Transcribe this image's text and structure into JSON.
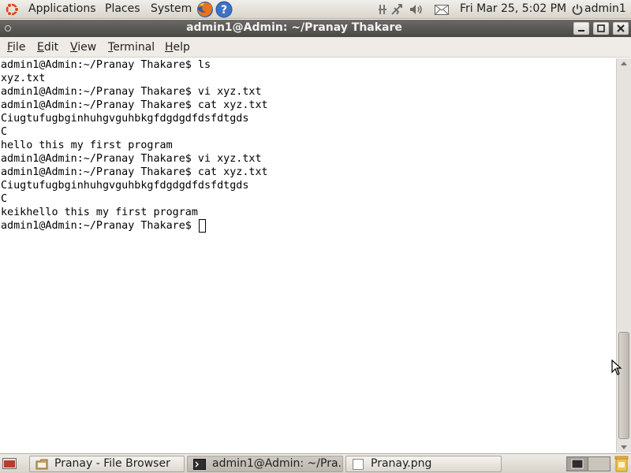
{
  "top_panel": {
    "menus": [
      "Applications",
      "Places",
      "System"
    ],
    "clock": "Fri Mar 25,  5:02 PM",
    "user": "admin1",
    "icons": [
      "ubuntu-logo-icon",
      "firefox-icon",
      "help-icon",
      "network-icon",
      "bluetooth-icon",
      "volume-icon",
      "mail-icon",
      "power-icon"
    ]
  },
  "window": {
    "title": "admin1@Admin: ~/Pranay Thakare"
  },
  "menubar": {
    "items": [
      {
        "label": "File",
        "mnemonic": "F",
        "rest": "ile"
      },
      {
        "label": "Edit",
        "mnemonic": "E",
        "rest": "dit"
      },
      {
        "label": "View",
        "mnemonic": "V",
        "rest": "iew"
      },
      {
        "label": "Terminal",
        "mnemonic": "T",
        "rest": "erminal"
      },
      {
        "label": "Help",
        "mnemonic": "H",
        "rest": "elp"
      }
    ]
  },
  "terminal": {
    "lines": [
      "admin1@Admin:~/Pranay Thakare$ ls",
      "xyz.txt",
      "admin1@Admin:~/Pranay Thakare$ vi xyz.txt",
      "admin1@Admin:~/Pranay Thakare$ cat xyz.txt",
      "Ciugtufugbginhuhgvguhbkgfdgdgdfdsfdtgds",
      "C",
      "hello this my first program",
      "admin1@Admin:~/Pranay Thakare$ vi xyz.txt",
      "admin1@Admin:~/Pranay Thakare$ cat xyz.txt",
      "Ciugtufugbginhuhgvguhbkgfdgdgdfdsfdtgds",
      "C",
      "keikhello this my first program"
    ],
    "prompt": "admin1@Admin:~/Pranay Thakare$ "
  },
  "taskbar": {
    "tasks": [
      {
        "label": "Pranay - File Browser",
        "icon": "folder-icon"
      },
      {
        "label": "admin1@Admin: ~/Pra...",
        "icon": "terminal-icon"
      },
      {
        "label": "Pranay.png",
        "icon": "image-file-icon"
      }
    ]
  },
  "colors": {
    "panel": "#dcd8d0",
    "titlebar": "#57544f",
    "terminal_bg": "#ffffff",
    "terminal_fg": "#000000"
  }
}
